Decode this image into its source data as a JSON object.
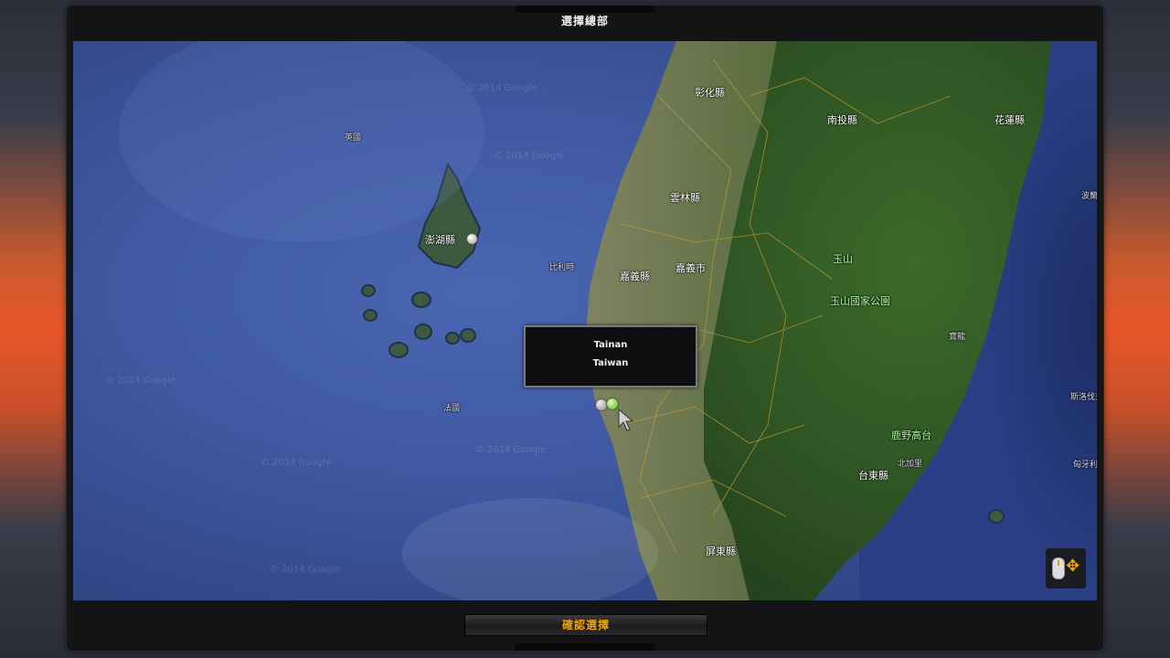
{
  "window": {
    "title": "選擇總部",
    "confirm_button": "確認選擇"
  },
  "map": {
    "tooltip": {
      "city": "Tainan",
      "country": "Taiwan"
    },
    "labels": {
      "changhua": "彰化縣",
      "nantou": "南投縣",
      "hualien": "花蓮縣",
      "yunlin": "雲林縣",
      "penghu": "澎湖縣",
      "chiayi_county": "嘉義縣",
      "chiayi_city": "嘉義市",
      "yushan": "玉山",
      "yushan_park": "玉山國家公園",
      "taitung": "台東縣",
      "pingtung": "屏東縣",
      "ying": "英國",
      "fa": "法國",
      "bilishi": "比利時",
      "bolan": "波蘭",
      "sgld": "斯洛伐克",
      "xiongyali": "匈牙利",
      "luye": "鹿野高台",
      "beijiali": "北加里",
      "fengyuan": "寶龍"
    },
    "watermark": "© 2014 Google"
  },
  "colors": {
    "accent": "#f0a400",
    "ocean": "#3f5aa3",
    "land": "#3e5f2a"
  },
  "icons": {
    "mouse": "mouse-icon",
    "move": "move-arrows-icon"
  }
}
